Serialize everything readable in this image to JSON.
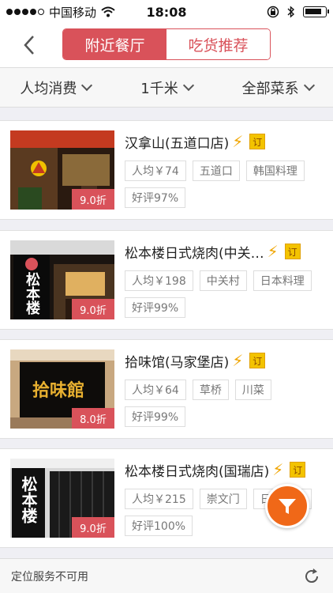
{
  "status": {
    "carrier": "中国移动",
    "time": "18:08"
  },
  "nav": {
    "tabs": [
      {
        "label": "附近餐厅",
        "active": true
      },
      {
        "label": "吃货推荐",
        "active": false
      }
    ]
  },
  "filters": [
    {
      "label": "人均消费"
    },
    {
      "label": "1千米"
    },
    {
      "label": "全部菜系"
    }
  ],
  "restaurants": [
    {
      "name": "汉拿山(五道口店)",
      "book": "订",
      "discount": "9.0折",
      "price": "人均￥74",
      "area": "五道口",
      "cuisine": "韩国料理",
      "rating": "好评97%"
    },
    {
      "name": "松本楼日式烧肉(中关…",
      "book": "订",
      "discount": "9.0折",
      "price": "人均￥198",
      "area": "中关村",
      "cuisine": "日本料理",
      "rating": "好评99%"
    },
    {
      "name": "拾味馆(马家堡店)",
      "book": "订",
      "discount": "8.0折",
      "price": "人均￥64",
      "area": "草桥",
      "cuisine": "川菜",
      "rating": "好评99%"
    },
    {
      "name": "松本楼日式烧肉(国瑞店)",
      "book": "订",
      "discount": "9.0折",
      "price": "人均￥215",
      "area": "崇文门",
      "cuisine": "日本料理",
      "rating": "好评100%"
    }
  ],
  "thumb_text": {
    "r2": "松本楼",
    "r3": "拾味館",
    "r4": "松本楼"
  },
  "footer": {
    "status_text": "定位服务不可用"
  },
  "colors": {
    "accent": "#d9525a",
    "fab": "#f06818",
    "book_badge": "#f3c300",
    "bolt": "#f0a500"
  }
}
